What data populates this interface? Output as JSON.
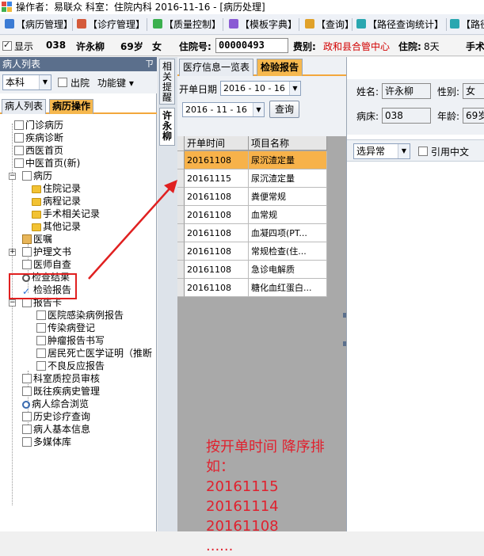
{
  "title_bar": {
    "text": "操作者：易联众  科室：住院内科  2016-11-16 - [病历处理]"
  },
  "menu": [
    {
      "label": "【病历管理】",
      "icon": "record-icon"
    },
    {
      "label": "【诊疗管理】",
      "icon": "treatment-icon"
    },
    {
      "label": "【质量控制】",
      "icon": "quality-icon"
    },
    {
      "label": "【模板字典】",
      "icon": "template-icon"
    },
    {
      "label": "【查询】",
      "icon": "query-icon"
    },
    {
      "label": "【路径查询统计】",
      "icon": "pathway-icon"
    },
    {
      "label": "【路径",
      "icon": "pathway2-icon"
    }
  ],
  "patient_bar": {
    "show_label": "显示",
    "show_checked": true,
    "bed": "038",
    "name": "许永柳",
    "age": "69岁",
    "sex": "女",
    "admission_label": "住院号:",
    "admission_no": "00000493",
    "fee_type_label": "费别:",
    "fee_type": "政和县合管中心",
    "stay_label": "住院:",
    "stay_days": "8天",
    "extra": "手术"
  },
  "left_panel": {
    "header": "病人列表",
    "pin": "ㄗ",
    "dept_combo": "本科",
    "discharged_label": "出院",
    "function_key_label": "功能键",
    "tabs": [
      "病人列表",
      "病历操作"
    ],
    "active_tab": 1,
    "tree": [
      {
        "label": "门诊病历"
      },
      {
        "label": "疾病诊断"
      },
      {
        "label": "西医首页"
      },
      {
        "label": "中医首页(新)"
      },
      {
        "label": "病历"
      },
      {
        "label": "住院记录"
      },
      {
        "label": "病程记录"
      },
      {
        "label": "手术相关记录"
      },
      {
        "label": "其他记录"
      },
      {
        "label": "医嘱"
      },
      {
        "label": "护理文书"
      },
      {
        "label": "医师自查"
      },
      {
        "label": "检查结果"
      },
      {
        "label": "检验报告"
      },
      {
        "label": "报告卡"
      },
      {
        "label": "医院感染病例报告"
      },
      {
        "label": "传染病登记"
      },
      {
        "label": "肿瘤报告书写"
      },
      {
        "label": "居民死亡医学证明（推断"
      },
      {
        "label": "不良反应报告"
      },
      {
        "label": "科室质控员审核"
      },
      {
        "label": "既往疾病史管理"
      },
      {
        "label": "病人综合浏览"
      },
      {
        "label": "历史诊疗查询"
      },
      {
        "label": "病人基本信息"
      },
      {
        "label": "多媒体库"
      }
    ]
  },
  "side_tabs": {
    "tab1": "相关提醒",
    "tab2": "许永柳"
  },
  "middle_panel": {
    "tabs": [
      "医疗信息一览表",
      "检验报告"
    ],
    "active_tab": 1,
    "start_date_label": "开单日期",
    "date_from": "2016 - 10 - 16",
    "date_to": "2016 - 11 - 16",
    "query_button": "查询",
    "grid_headers": [
      "开单时间",
      "项目名称"
    ],
    "rows": [
      {
        "date": "20161108",
        "item": "尿沉渣定量",
        "selected": true
      },
      {
        "date": "20161115",
        "item": "尿沉渣定量",
        "selected": false
      },
      {
        "date": "20161108",
        "item": "粪便常规",
        "selected": false
      },
      {
        "date": "20161108",
        "item": "血常规",
        "selected": false
      },
      {
        "date": "20161108",
        "item": "血凝四项(PT...",
        "selected": false
      },
      {
        "date": "20161108",
        "item": "常规检查(住...",
        "selected": false
      },
      {
        "date": "20161108",
        "item": "急诊电解质",
        "selected": false
      },
      {
        "date": "20161108",
        "item": "糖化血红蛋白...",
        "selected": false
      }
    ],
    "annotation": [
      "按开单时间 降序排",
      "如：",
      "20161115",
      "20161114",
      "20161108",
      "......"
    ]
  },
  "right_panel": {
    "name_label": "姓名:",
    "name_value": "许永柳",
    "sex_label": "性别:",
    "sex_value": "女",
    "bed_label": "病床:",
    "bed_value": "038",
    "age_label": "年龄:",
    "age_value": "69岁",
    "filter_value": "选异常",
    "quote_label": "引用中文"
  },
  "colors": {
    "accent_orange": "#f6b84e",
    "annotation_red": "#e0212e",
    "header_blue": "#5b6f8c"
  }
}
